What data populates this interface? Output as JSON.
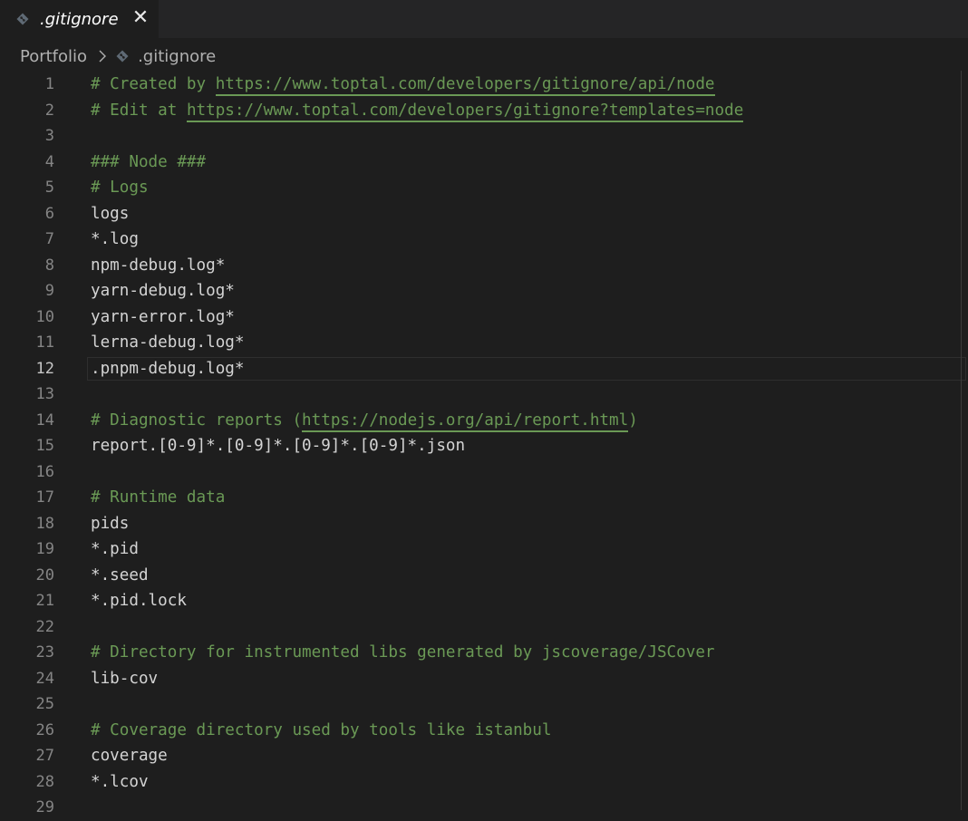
{
  "tab": {
    "label": ".gitignore",
    "close_glyph": "✕",
    "icon": "gitignore-file-icon"
  },
  "breadcrumb": {
    "folder": "Portfolio",
    "file": ".gitignore",
    "separator_icon": "chevron-right-icon"
  },
  "editor": {
    "active_line": 12,
    "lines": [
      {
        "num": "1",
        "type": "comment-link",
        "prefix": "# Created by ",
        "link": "https://www.toptal.com/developers/gitignore/api/node",
        "suffix": ""
      },
      {
        "num": "2",
        "type": "comment-link",
        "prefix": "# Edit at ",
        "link": "https://www.toptal.com/developers/gitignore?templates=node",
        "suffix": ""
      },
      {
        "num": "3",
        "type": "plain",
        "text": ""
      },
      {
        "num": "4",
        "type": "comment",
        "text": "### Node ###"
      },
      {
        "num": "5",
        "type": "comment",
        "text": "# Logs"
      },
      {
        "num": "6",
        "type": "plain",
        "text": "logs"
      },
      {
        "num": "7",
        "type": "plain",
        "text": "*.log"
      },
      {
        "num": "8",
        "type": "plain",
        "text": "npm-debug.log*"
      },
      {
        "num": "9",
        "type": "plain",
        "text": "yarn-debug.log*"
      },
      {
        "num": "10",
        "type": "plain",
        "text": "yarn-error.log*"
      },
      {
        "num": "11",
        "type": "plain",
        "text": "lerna-debug.log*"
      },
      {
        "num": "12",
        "type": "plain",
        "text": ".pnpm-debug.log*"
      },
      {
        "num": "13",
        "type": "plain",
        "text": ""
      },
      {
        "num": "14",
        "type": "comment-link",
        "prefix": "# Diagnostic reports (",
        "link": "https://nodejs.org/api/report.html",
        "suffix": ")"
      },
      {
        "num": "15",
        "type": "plain",
        "text": "report.[0-9]*.[0-9]*.[0-9]*.[0-9]*.json"
      },
      {
        "num": "16",
        "type": "plain",
        "text": ""
      },
      {
        "num": "17",
        "type": "comment",
        "text": "# Runtime data"
      },
      {
        "num": "18",
        "type": "plain",
        "text": "pids"
      },
      {
        "num": "19",
        "type": "plain",
        "text": "*.pid"
      },
      {
        "num": "20",
        "type": "plain",
        "text": "*.seed"
      },
      {
        "num": "21",
        "type": "plain",
        "text": "*.pid.lock"
      },
      {
        "num": "22",
        "type": "plain",
        "text": ""
      },
      {
        "num": "23",
        "type": "comment",
        "text": "# Directory for instrumented libs generated by jscoverage/JSCover"
      },
      {
        "num": "24",
        "type": "plain",
        "text": "lib-cov"
      },
      {
        "num": "25",
        "type": "plain",
        "text": ""
      },
      {
        "num": "26",
        "type": "comment",
        "text": "# Coverage directory used by tools like istanbul"
      },
      {
        "num": "27",
        "type": "plain",
        "text": "coverage"
      },
      {
        "num": "28",
        "type": "plain",
        "text": "*.lcov"
      },
      {
        "num": "29",
        "type": "plain",
        "text": ""
      }
    ]
  },
  "colors": {
    "background": "#1e1e1e",
    "comment": "#6a9955",
    "text": "#d4d4d4",
    "line_number": "#858585"
  }
}
